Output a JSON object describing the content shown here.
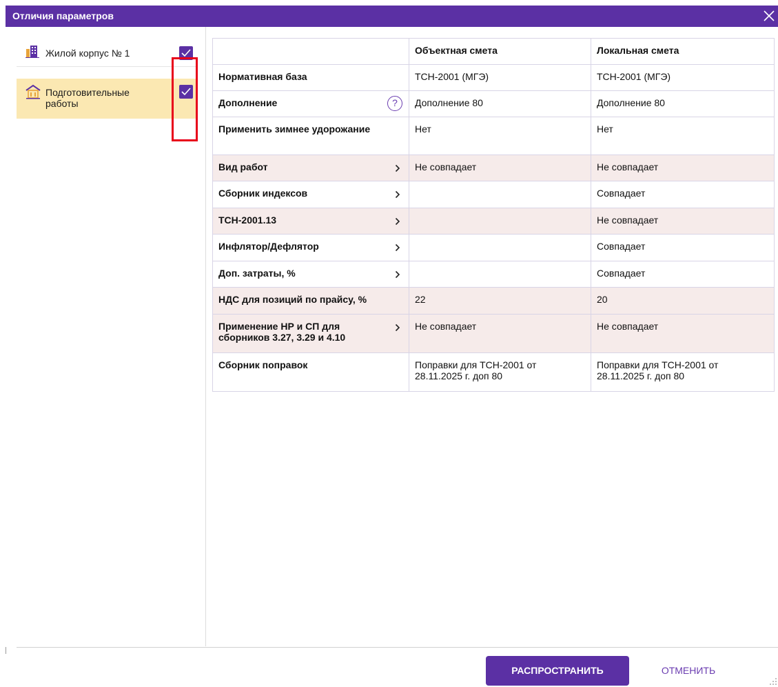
{
  "window": {
    "title": "Отличия параметров"
  },
  "sidebar": {
    "items": [
      {
        "label": "Жилой корпус № 1",
        "icon": "building-icon",
        "checked": true
      },
      {
        "label": "Подготовительные работы",
        "icon": "house-icon",
        "checked": true,
        "selected": true
      }
    ]
  },
  "table": {
    "headers": [
      "",
      "Объектная смета",
      "Локальная смета"
    ],
    "rows": [
      {
        "name": "Нормативная база",
        "obj": "ТСН-2001 (МГЭ)",
        "loc": "ТСН-2001 (МГЭ)"
      },
      {
        "name": "Дополнение",
        "obj": "Дополнение 80",
        "loc": "Дополнение 80",
        "help": "?"
      },
      {
        "name": "Применить зимнее удорожание",
        "obj": "Нет",
        "loc": "Нет"
      },
      {
        "name": "Вид работ",
        "obj": "Не совпадает",
        "loc": "Не совпадает",
        "expandable": true,
        "diff": true
      },
      {
        "name": "Сборник индексов",
        "obj": "",
        "loc": "Совпадает",
        "expandable": true
      },
      {
        "name": "ТСН-2001.13",
        "obj": "",
        "loc": "Не совпадает",
        "expandable": true,
        "diff": true
      },
      {
        "name": "Инфлятор/Дефлятор",
        "obj": "",
        "loc": "Совпадает",
        "expandable": true
      },
      {
        "name": "Доп. затраты, %",
        "obj": "",
        "loc": "Совпадает",
        "expandable": true
      },
      {
        "name": "НДС для позиций по прайсу, %",
        "obj": "22",
        "loc": "20",
        "diff": true
      },
      {
        "name": "Применение НР и СП для сборников 3.27, 3.29 и 4.10",
        "obj": "Не совпадает",
        "loc": "Не совпадает",
        "expandable": true,
        "diff": true
      },
      {
        "name": "Сборник поправок",
        "obj": "Поправки для ТСН-2001 от 28.11.2025 г. доп 80",
        "loc": "Поправки для ТСН-2001 от 28.11.2025 г. доп 80"
      }
    ]
  },
  "footer": {
    "apply_label": "РАСПРОСТРАНИТЬ",
    "cancel_label": "ОТМЕНИТЬ"
  },
  "colors": {
    "accent": "#5b30a4",
    "diff_row": "#f6ebea",
    "selected_item": "#fbe8b2",
    "highlight": "#e8001a"
  }
}
